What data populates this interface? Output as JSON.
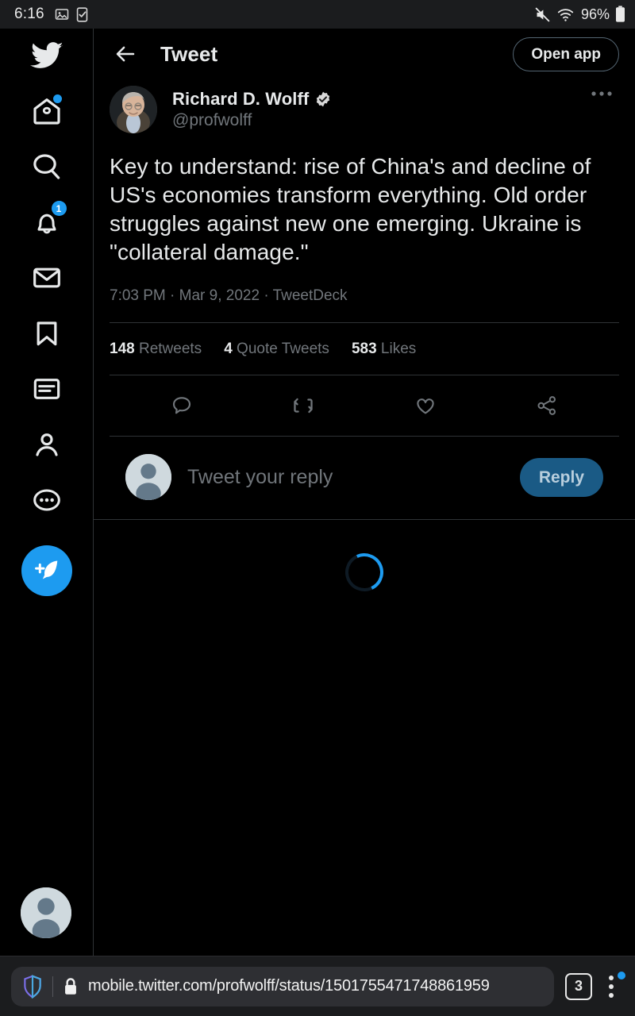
{
  "status_bar": {
    "time": "6:16",
    "battery_percent": "96%",
    "icons": [
      "image-icon",
      "checkbox-icon",
      "mute-icon",
      "wifi-icon",
      "battery-icon"
    ]
  },
  "sidebar": {
    "items": [
      {
        "name": "twitter-logo",
        "label": "Twitter"
      },
      {
        "name": "home",
        "label": "Home",
        "badge_dot": true
      },
      {
        "name": "explore",
        "label": "Explore"
      },
      {
        "name": "notifications",
        "label": "Notifications",
        "badge": "1"
      },
      {
        "name": "messages",
        "label": "Messages"
      },
      {
        "name": "bookmarks",
        "label": "Bookmarks"
      },
      {
        "name": "lists",
        "label": "Lists"
      },
      {
        "name": "profile",
        "label": "Profile"
      },
      {
        "name": "more",
        "label": "More"
      }
    ],
    "compose_label": "Tweet",
    "account_avatar_label": "Account"
  },
  "appbar": {
    "back_label": "Back",
    "title": "Tweet",
    "open_app_label": "Open app"
  },
  "tweet": {
    "display_name": "Richard D. Wolff",
    "verified": true,
    "handle": "@profwolff",
    "more_label": "More",
    "text": "Key to understand: rise of China's and decline of US's economies transform everything. Old order struggles against new one emerging. Ukraine is \"collateral damage.\"",
    "timestamp": "7:03 PM · Mar 9, 2022 · TweetDeck",
    "stats": [
      {
        "count": "148",
        "label": "Retweets"
      },
      {
        "count": "4",
        "label": "Quote Tweets"
      },
      {
        "count": "583",
        "label": "Likes"
      }
    ],
    "actions": [
      {
        "name": "reply-icon",
        "label": "Reply"
      },
      {
        "name": "retweet-icon",
        "label": "Retweet"
      },
      {
        "name": "like-icon",
        "label": "Like"
      },
      {
        "name": "share-icon",
        "label": "Share"
      }
    ]
  },
  "composer": {
    "placeholder": "Tweet your reply",
    "reply_button_label": "Reply"
  },
  "loading": {
    "state": "loading-replies"
  },
  "browser": {
    "shield_label": "Shields",
    "lock_label": "Secure",
    "url": "mobile.twitter.com/profwolff/status/1501755471748861959",
    "tab_count": "3",
    "menu_label": "Menu",
    "menu_has_update_dot": true
  },
  "colors": {
    "accent": "#1d9bf0",
    "background": "#000000",
    "chrome": "#1b1c1e",
    "muted_text": "#71767b",
    "divider": "#2f3336",
    "reply_button": "#1a5a85"
  }
}
